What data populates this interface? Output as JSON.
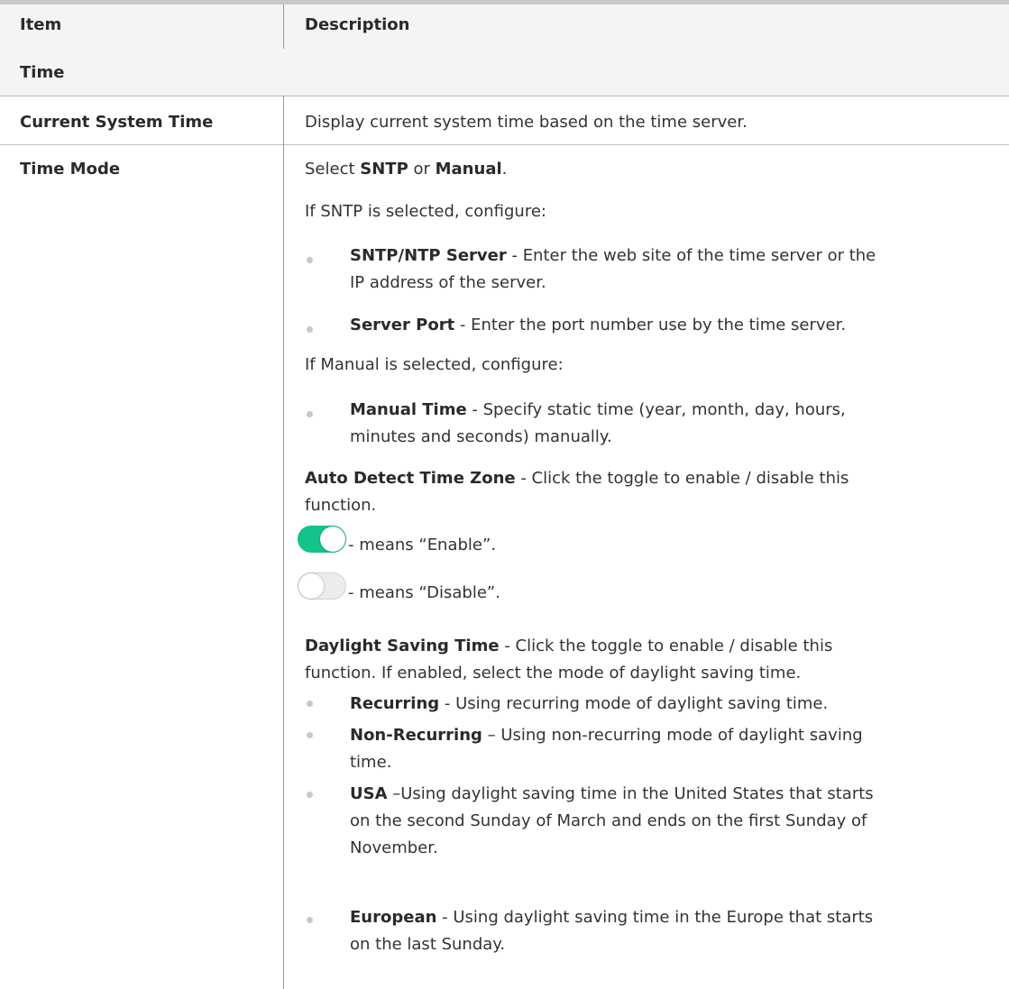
{
  "table": {
    "header": {
      "item": "Item",
      "description": "Description"
    },
    "section_title": "Time",
    "rows": {
      "current_time": {
        "item": "Current System Time",
        "description": "Display current system time based on the time server."
      },
      "time_mode": {
        "item": "Time Mode",
        "select_prefix": "Select ",
        "select_sntp": "SNTP",
        "select_or": " or ",
        "select_manual": "Manual",
        "select_suffix": ".",
        "sntp_intro": "If SNTP is selected, configure:",
        "sntp_bullets": [
          {
            "term": "SNTP/NTP Server",
            "line1": " - Enter the web site of the time server or the",
            "line2": "IP address of the server."
          },
          {
            "term": "Server Port",
            "line1": " - Enter the port number use by the time server."
          }
        ],
        "manual_intro": "If Manual is selected, configure:",
        "manual_bullet": {
          "term": "Manual Time",
          "line1": " - Specify static time (year, month, day, hours,",
          "line2": "minutes and seconds) manually."
        },
        "auto_detect": {
          "term": "Auto Detect Time Zone",
          "line1": " - Click the toggle to enable / disable this",
          "line2": "function."
        },
        "toggle_on_text": " - means “Enable”.",
        "toggle_off_text": " - means “Disable”.",
        "dst": {
          "term": "Daylight Saving Time",
          "line1": " - Click the toggle to enable / disable this",
          "line2": "function. If enabled, select the mode of daylight saving time."
        },
        "dst_bullets": [
          {
            "term": "Recurring",
            "line1": " - Using recurring mode of daylight saving time."
          },
          {
            "term": "Non-Recurring",
            "line1": " – Using non-recurring mode of daylight saving",
            "line2": "time."
          },
          {
            "term": "USA",
            "line1": " –Using daylight saving time in the United States that starts",
            "line2": "on the second Sunday of March and ends on the first Sunday of",
            "line3": "November."
          },
          {
            "term": "European",
            "line1": " - Using daylight saving time in the Europe that starts",
            "line2": "on the last Sunday."
          }
        ]
      }
    }
  },
  "colors": {
    "toggle_on": "#14c28a",
    "toggle_off": "#e8e8e8",
    "bullet": "#c8c8c8",
    "header_bg": "#f4f4f4"
  }
}
